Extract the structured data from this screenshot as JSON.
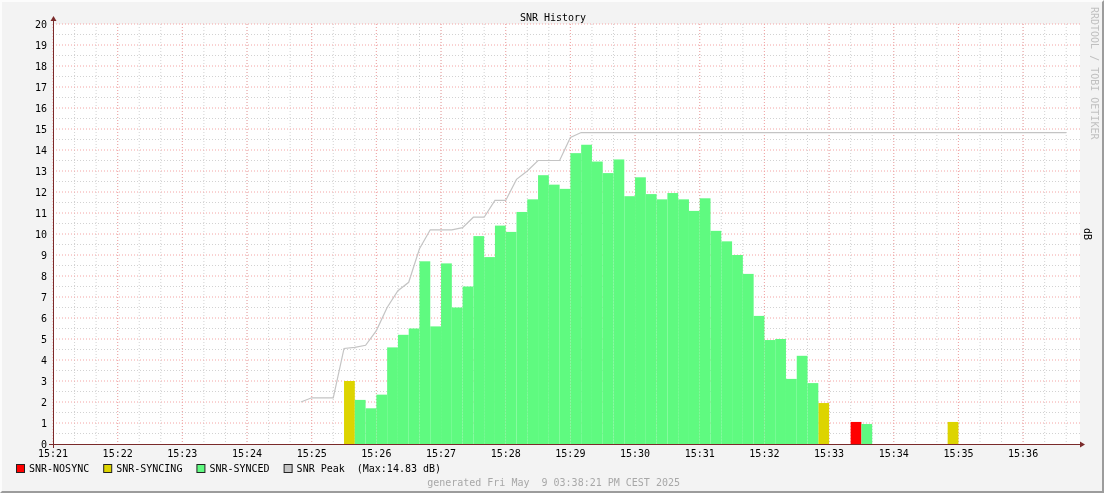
{
  "graph": {
    "chart_data": {
      "type": "bar",
      "title": "SNR History",
      "ylabel": "dB",
      "categories": [
        "15:21",
        null,
        null,
        null,
        null,
        null,
        "15:22",
        null,
        null,
        null,
        null,
        null,
        "15:23",
        null,
        null,
        null,
        null,
        null,
        "15:24",
        null,
        null,
        null,
        null,
        null,
        "15:25",
        null,
        null,
        null,
        null,
        null,
        "15:26",
        null,
        null,
        null,
        null,
        null,
        "15:27",
        null,
        null,
        null,
        null,
        null,
        "15:28",
        null,
        null,
        null,
        null,
        null,
        "15:29",
        null,
        null,
        null,
        null,
        null,
        "15:30",
        null,
        null,
        null,
        null,
        null,
        "15:31",
        null,
        null,
        null,
        null,
        null,
        "15:32",
        null,
        null,
        null,
        null,
        null,
        "15:33",
        null,
        null,
        null,
        null,
        null,
        "15:34",
        null,
        null,
        null,
        null,
        null,
        "15:35",
        null,
        null,
        null,
        null,
        null,
        "15:36",
        null,
        null,
        null,
        null
      ],
      "ylim": [
        0,
        20
      ],
      "grid": true,
      "legend": "bottom",
      "yticks": [
        0,
        1,
        2,
        3,
        4,
        5,
        6,
        7,
        8,
        9,
        10,
        11,
        12,
        13,
        14,
        15,
        16,
        17,
        18,
        19,
        20
      ],
      "series": [
        {
          "name": "SNR-NOSYNC",
          "color": "#ff0000",
          "values": [
            null,
            null,
            null,
            null,
            null,
            null,
            null,
            null,
            null,
            null,
            null,
            null,
            null,
            null,
            null,
            null,
            null,
            null,
            null,
            null,
            null,
            null,
            null,
            null,
            null,
            null,
            null,
            null,
            null,
            null,
            null,
            null,
            null,
            null,
            null,
            null,
            null,
            null,
            null,
            null,
            null,
            null,
            null,
            null,
            null,
            null,
            null,
            null,
            null,
            null,
            null,
            null,
            null,
            null,
            null,
            null,
            null,
            null,
            null,
            null,
            null,
            null,
            null,
            null,
            null,
            null,
            null,
            null,
            null,
            null,
            null,
            null,
            null,
            null,
            1.05,
            null,
            null,
            null,
            null,
            null,
            null,
            null,
            null,
            null,
            null,
            null,
            null,
            null,
            null,
            null,
            null,
            null,
            null,
            null,
            null
          ]
        },
        {
          "name": "SNR-SYNCING",
          "color": "#ddd400",
          "values": [
            null,
            null,
            null,
            null,
            null,
            null,
            null,
            null,
            null,
            null,
            null,
            null,
            null,
            null,
            null,
            null,
            null,
            null,
            null,
            null,
            null,
            null,
            null,
            null,
            null,
            null,
            null,
            3.0,
            null,
            null,
            null,
            null,
            null,
            null,
            null,
            null,
            null,
            null,
            null,
            null,
            null,
            null,
            null,
            null,
            null,
            null,
            null,
            null,
            null,
            null,
            null,
            null,
            null,
            null,
            null,
            null,
            null,
            null,
            null,
            null,
            null,
            null,
            null,
            null,
            null,
            null,
            null,
            null,
            null,
            null,
            null,
            1.95,
            null,
            null,
            null,
            null,
            null,
            null,
            null,
            null,
            null,
            null,
            null,
            1.05,
            null,
            null,
            null,
            null,
            null,
            null,
            null,
            null,
            null,
            null,
            null
          ]
        },
        {
          "name": "SNR-SYNCED",
          "color": "#5ffa80",
          "values": [
            null,
            null,
            null,
            null,
            null,
            null,
            null,
            null,
            null,
            null,
            null,
            null,
            null,
            null,
            null,
            null,
            null,
            null,
            null,
            null,
            null,
            null,
            null,
            null,
            null,
            null,
            null,
            null,
            2.1,
            1.7,
            2.35,
            4.6,
            5.2,
            5.5,
            8.7,
            5.6,
            8.6,
            6.5,
            7.5,
            9.9,
            8.9,
            10.4,
            10.1,
            11.05,
            11.65,
            12.8,
            12.35,
            12.15,
            13.85,
            14.25,
            13.45,
            12.9,
            13.55,
            11.8,
            12.7,
            11.9,
            11.65,
            11.95,
            11.65,
            11.1,
            11.7,
            10.15,
            9.65,
            9.0,
            8.1,
            6.1,
            4.95,
            5.0,
            3.1,
            4.2,
            2.9,
            null,
            null,
            null,
            null,
            0.95,
            null,
            null,
            null,
            null,
            null,
            null,
            null,
            null,
            null,
            null,
            null,
            null,
            null,
            null,
            null,
            null,
            null,
            null,
            null
          ]
        },
        {
          "name": "SNR Peak",
          "color": "#c4c4c4",
          "type": "line",
          "values": [
            null,
            null,
            null,
            null,
            null,
            null,
            null,
            null,
            null,
            null,
            null,
            null,
            null,
            null,
            null,
            null,
            null,
            null,
            null,
            null,
            null,
            null,
            null,
            2.0,
            2.2,
            2.2,
            2.2,
            4.55,
            4.6,
            4.7,
            5.4,
            6.5,
            7.3,
            7.7,
            9.3,
            10.2,
            10.2,
            10.2,
            10.3,
            10.8,
            10.8,
            11.6,
            11.6,
            12.6,
            13.0,
            13.5,
            13.5,
            13.5,
            14.6,
            14.83,
            14.83,
            14.83,
            14.83,
            14.83,
            14.83,
            14.83,
            14.83,
            14.83,
            14.83,
            14.83,
            14.83,
            14.83,
            14.83,
            14.83,
            14.83,
            14.83,
            14.83,
            14.83,
            14.83,
            14.83,
            14.83,
            14.83,
            14.83,
            14.83,
            14.83,
            14.83,
            14.83,
            14.83,
            14.83,
            14.83,
            14.83,
            14.83,
            14.83,
            14.83,
            14.83,
            14.83,
            14.83,
            14.83,
            14.83,
            14.83,
            14.83,
            14.83,
            14.83,
            14.83,
            14.83
          ]
        }
      ]
    },
    "legend_note": "(Max:14.83 dB)",
    "side_text": "RRDTOOL / TOBI OETIKER",
    "footer": "generated Fri May  9 03:38:21 PM CEST 2025"
  }
}
